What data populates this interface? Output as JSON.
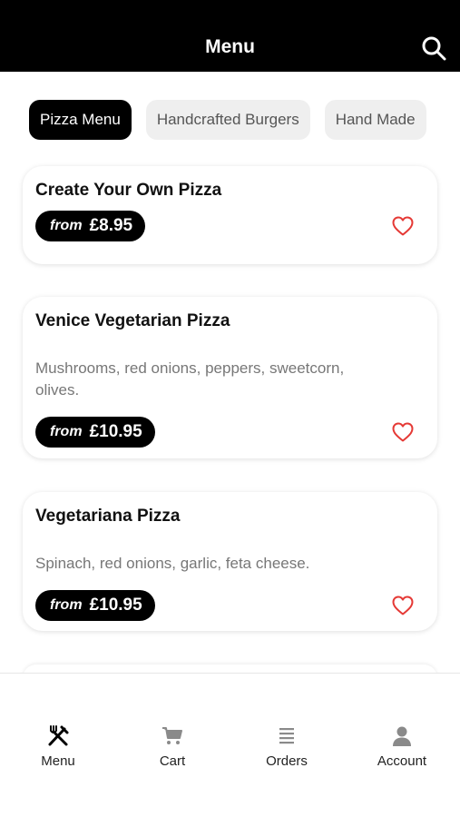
{
  "header": {
    "title": "Menu",
    "search_icon": "search-icon"
  },
  "categories": [
    {
      "label": "Pizza Menu",
      "active": true
    },
    {
      "label": "Handcrafted Burgers",
      "active": false
    },
    {
      "label": "Hand Made",
      "active": false
    }
  ],
  "items": [
    {
      "name": "Create Your Own Pizza",
      "description": "",
      "price_prefix": "from",
      "price": "£8.95",
      "favorite_icon": "heart-outline-icon"
    },
    {
      "name": "Venice Vegetarian Pizza",
      "description": "Mushrooms, red onions, peppers, sweetcorn, olives.",
      "price_prefix": "from",
      "price": "£10.95",
      "favorite_icon": "heart-outline-icon"
    },
    {
      "name": "Vegetariana Pizza",
      "description": "Spinach, red onions, garlic, feta cheese.",
      "price_prefix": "from",
      "price": "£10.95",
      "favorite_icon": "heart-outline-icon"
    }
  ],
  "colors": {
    "header_bg": "#000000",
    "accent_heart": "#e53935",
    "chip_active_bg": "#000000",
    "chip_bg": "#efefef",
    "description_text": "#777777"
  },
  "tabbar": {
    "items": [
      {
        "label": "Menu",
        "icon": "fork-knife-icon",
        "active": true
      },
      {
        "label": "Cart",
        "icon": "cart-icon",
        "active": false
      },
      {
        "label": "Orders",
        "icon": "list-icon",
        "active": false
      },
      {
        "label": "Account",
        "icon": "person-icon",
        "active": false
      }
    ]
  }
}
